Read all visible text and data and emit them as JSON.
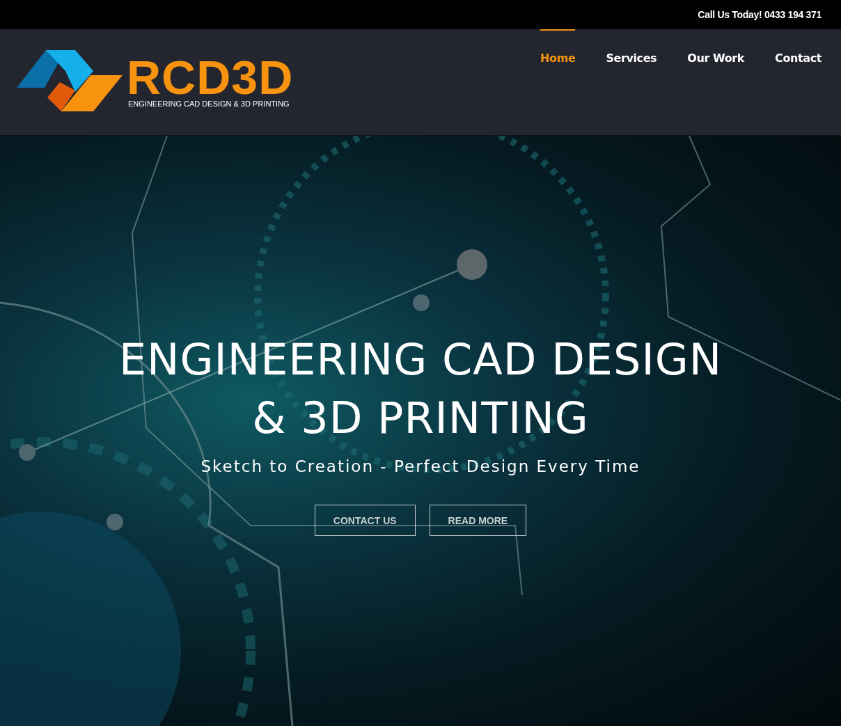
{
  "top_bar": {
    "text": "Call Us Today! 0433 194 371"
  },
  "logo": {
    "name": "RCD3D",
    "tagline": "ENGINEERING CAD DESIGN & 3D PRINTING"
  },
  "nav": [
    {
      "label": "Home",
      "selected": true
    },
    {
      "label": "Services",
      "selected": false
    },
    {
      "label": "Our Work",
      "selected": false
    },
    {
      "label": "Contact",
      "selected": false
    }
  ],
  "hero": {
    "title_lines": [
      "ENGINEERING CAD DESIGN",
      "& 3D PRINTING"
    ],
    "subtitle": "Sketch to Creation - Perfect Design Every Time",
    "buttons": [
      "CONTACT US",
      "READ MORE"
    ]
  }
}
